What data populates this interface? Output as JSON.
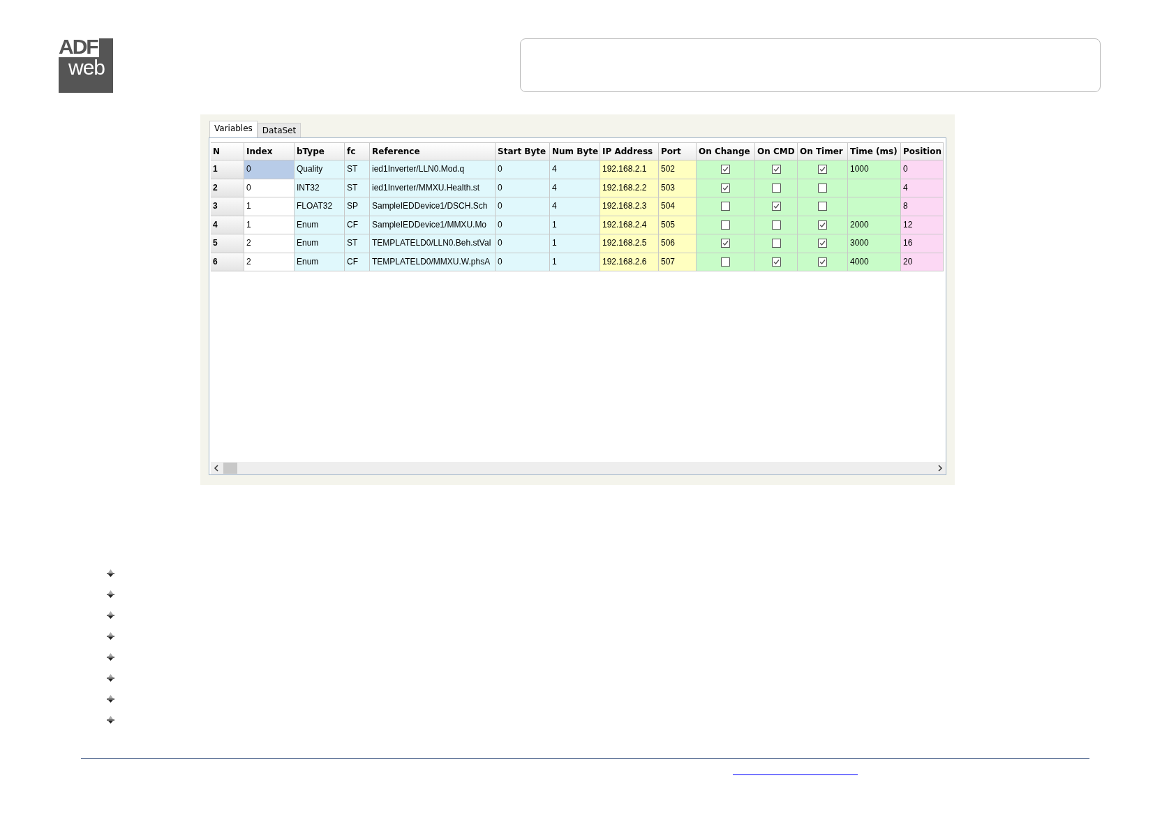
{
  "logo": {
    "top": "ADF",
    "bottom": "web"
  },
  "tabs": [
    {
      "label": "Variables",
      "selected": true
    },
    {
      "label": "DataSet",
      "selected": false
    }
  ],
  "table": {
    "columns": [
      {
        "label": "N",
        "kind": "head",
        "color": "#f0f0f0"
      },
      {
        "label": "Index",
        "kind": "text"
      },
      {
        "label": "bType",
        "kind": "text",
        "color": "#e0f8fc"
      },
      {
        "label": "fc",
        "kind": "text",
        "color": "#e0f8fc"
      },
      {
        "label": "Reference",
        "kind": "text",
        "color": "#e0f8fc"
      },
      {
        "label": "Start Byte",
        "kind": "text",
        "color": "#e0f8fc"
      },
      {
        "label": "Num Byte",
        "kind": "text",
        "color": "#e0f8fc"
      },
      {
        "label": "IP Address",
        "kind": "text",
        "color": "#ffffc0"
      },
      {
        "label": "Port",
        "kind": "text",
        "color": "#ffffc0"
      },
      {
        "label": "On Change",
        "kind": "check",
        "color": "#c8fcc8"
      },
      {
        "label": "On CMD",
        "kind": "check",
        "color": "#c8fcc8"
      },
      {
        "label": "On Timer",
        "kind": "check",
        "color": "#c8fcc8"
      },
      {
        "label": "Time (ms)",
        "kind": "text",
        "color": "#c8fcc8"
      },
      {
        "label": "Position",
        "kind": "text",
        "color": "#fcd8f4"
      }
    ],
    "rows": [
      {
        "selected": true,
        "cells": [
          "1",
          "0",
          "Quality",
          "ST",
          "ied1Inverter/LLN0.Mod.q",
          "0",
          "4",
          "192.168.2.1",
          "502",
          {
            "checked": true
          },
          {
            "checked": true
          },
          {
            "checked": true
          },
          "1000",
          "0"
        ]
      },
      {
        "selected": false,
        "cells": [
          "2",
          "0",
          "INT32",
          "ST",
          "ied1Inverter/MMXU.Health.st",
          "0",
          "4",
          "192.168.2.2",
          "503",
          {
            "checked": true
          },
          {
            "checked": false
          },
          {
            "checked": false
          },
          null,
          "4"
        ]
      },
      {
        "selected": false,
        "cells": [
          "3",
          "1",
          "FLOAT32",
          "SP",
          "SampleIEDDevice1/DSCH.Sch",
          "0",
          "4",
          "192.168.2.3",
          "504",
          {
            "checked": false
          },
          {
            "checked": true
          },
          {
            "checked": false
          },
          null,
          "8"
        ]
      },
      {
        "selected": false,
        "cells": [
          "4",
          "1",
          "Enum",
          "CF",
          "SampleIEDDevice1/MMXU.Mo",
          "0",
          "1",
          "192.168.2.4",
          "505",
          {
            "checked": false
          },
          {
            "checked": false
          },
          {
            "checked": true
          },
          "2000",
          "12"
        ]
      },
      {
        "selected": false,
        "cells": [
          "5",
          "2",
          "Enum",
          "ST",
          "TEMPLATELD0/LLN0.Beh.stVal",
          "0",
          "1",
          "192.168.2.5",
          "506",
          {
            "checked": true
          },
          {
            "checked": false
          },
          {
            "checked": true
          },
          "3000",
          "16"
        ]
      },
      {
        "selected": false,
        "cells": [
          "6",
          "2",
          "Enum",
          "CF",
          "TEMPLATELD0/MMXU.W.phsA",
          "0",
          "1",
          "192.168.2.6",
          "507",
          {
            "checked": false
          },
          {
            "checked": true
          },
          {
            "checked": true
          },
          "4000",
          "20"
        ]
      }
    ]
  }
}
